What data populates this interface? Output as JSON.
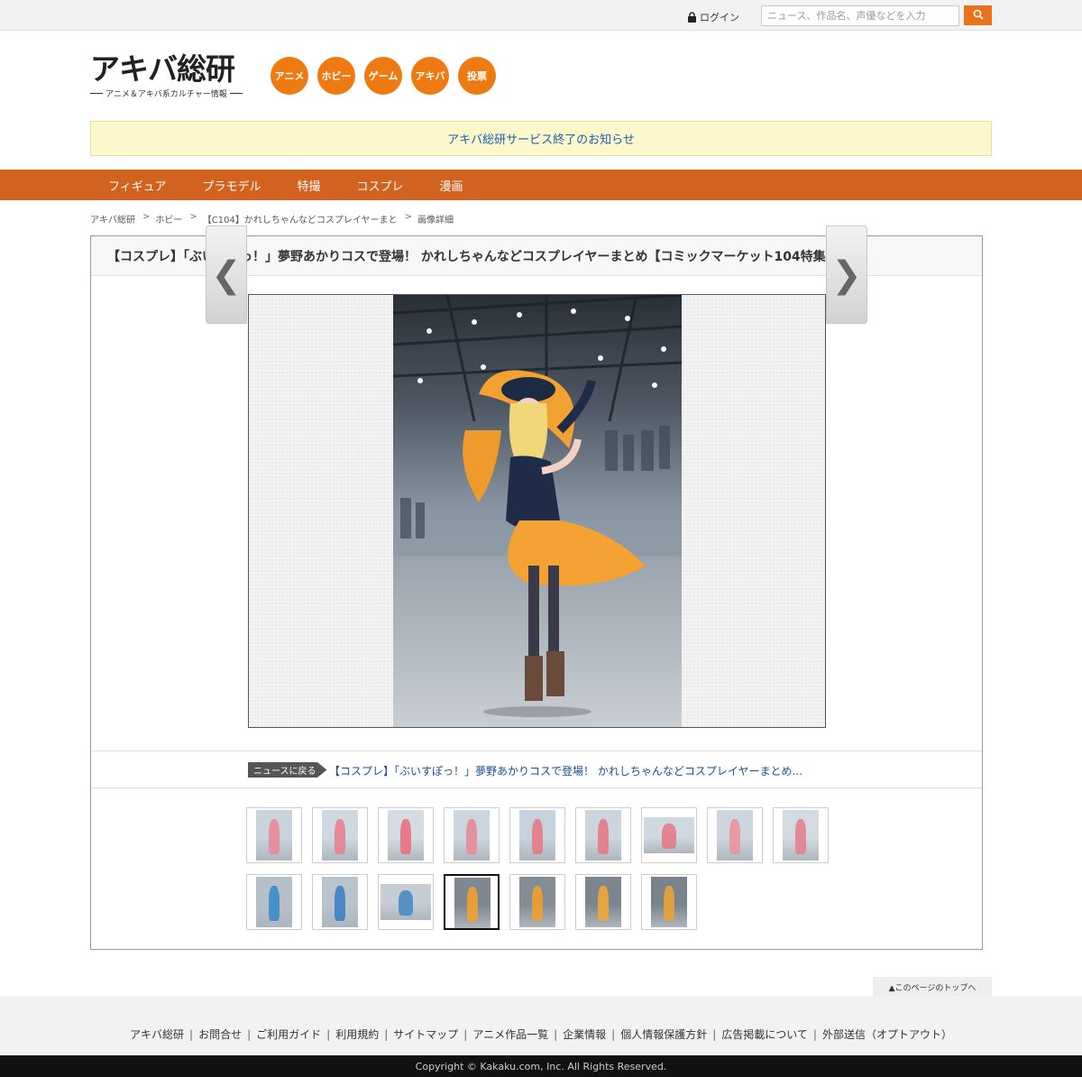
{
  "topbar": {
    "login_label": "ログイン",
    "search_placeholder": "ニュース、作品名、声優などを入力"
  },
  "logo": {
    "main": "アキバ総研",
    "sub": "アニメ＆アキバ系カルチャー情報"
  },
  "categories": [
    "アニメ",
    "ホビー",
    "ゲーム",
    "アキバ",
    "投票"
  ],
  "notice": "アキバ総研サービス終了のお知らせ",
  "main_nav": [
    "フィギュア",
    "プラモデル",
    "特撮",
    "コスプレ",
    "漫画"
  ],
  "breadcrumb": [
    "アキバ総研",
    "ホビー",
    "【C104】かれしちゃんなどコスプレイヤーまと",
    "画像詳細"
  ],
  "article": {
    "title": "【コスプレ】「ぶいすぽっ！」夢野あかりコスで登場！ かれしちゃんなどコスプレイヤーまとめ【コミックマーケット104特集】",
    "back_label": "ニュースに戻る",
    "back_link": "【コスプレ】「ぶいすぽっ！」夢野あかりコスで登場！ かれしちゃんなどコスプレイヤーまとめ..."
  },
  "viewer": {
    "prev_glyph": "❮",
    "next_glyph": "❯"
  },
  "thumbnails": {
    "row1": [
      {
        "tone": "#c9d3de",
        "accent": "#e88a9a"
      },
      {
        "tone": "#cfd8e2",
        "accent": "#e8808f"
      },
      {
        "tone": "#d4dbe3",
        "accent": "#e9707f"
      },
      {
        "tone": "#cbd6e0",
        "accent": "#e98a98"
      },
      {
        "tone": "#c6d2de",
        "accent": "#e77a86"
      },
      {
        "tone": "#ccd5df",
        "accent": "#e77985"
      },
      {
        "tone": "#d0d8e0",
        "accent": "#e57b8a",
        "wide": true
      },
      {
        "tone": "#cdd6df",
        "accent": "#e8939e"
      },
      {
        "tone": "#d2dae2",
        "accent": "#e68090"
      }
    ],
    "row2": [
      {
        "tone": "#b7c0c9",
        "accent": "#3a8cc8"
      },
      {
        "tone": "#b9c3cc",
        "accent": "#3d7fc2"
      },
      {
        "tone": "#c6cdd4",
        "accent": "#4a8cc4",
        "wide": true
      },
      {
        "tone": "#7f8790",
        "accent": "#f0a233",
        "selected": true
      },
      {
        "tone": "#848c95",
        "accent": "#ef9f30"
      },
      {
        "tone": "#7d858e",
        "accent": "#f2a838"
      },
      {
        "tone": "#7a828b",
        "accent": "#e9a13a"
      }
    ]
  },
  "pagetop": "▲このページのトップへ",
  "footer": {
    "links": [
      "アキバ総研",
      "お問合せ",
      "ご利用ガイド",
      "利用規約",
      "サイトマップ",
      "アニメ作品一覧",
      "企業情報",
      "個人情報保護方針",
      "広告掲載について",
      "外部送信（オプトアウト）"
    ],
    "copyright": "Copyright © Kakaku.com, Inc. All Rights Reserved."
  },
  "colors": {
    "accent_orange": "#f07a12",
    "nav_orange": "#d2621f",
    "link_blue": "#1a5ea8"
  }
}
